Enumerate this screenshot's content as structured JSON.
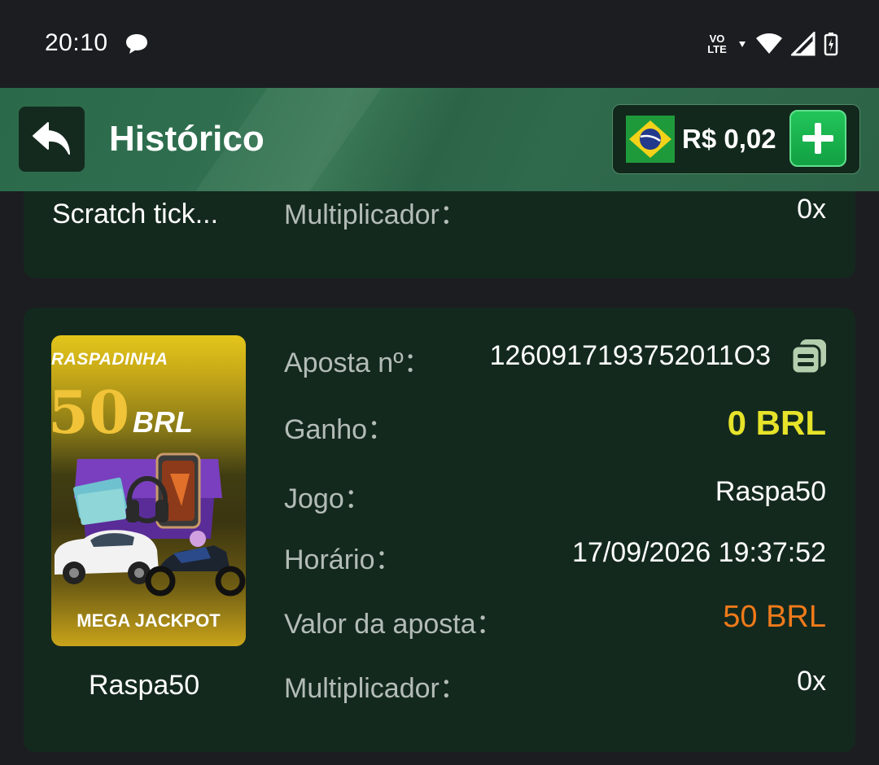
{
  "status_bar": {
    "time": "20:10",
    "network": "VO\nLTE"
  },
  "header": {
    "title": "Histórico",
    "balance": "R$ 0,02"
  },
  "partial_card": {
    "game_name": "Scratch tick...",
    "multiplier_label": "Multiplicador：",
    "multiplier_value": "0x"
  },
  "bet_card": {
    "thumbnail": {
      "title": "RASPADINHA",
      "amount": "50",
      "currency": "BRL",
      "banner": "MEGA JACKPOT"
    },
    "game_name": "Raspa50",
    "rows": [
      {
        "label": "Aposta nº：",
        "value": "1260917193752011O3"
      },
      {
        "label": "Ganho：",
        "value": "0 BRL"
      },
      {
        "label": "Jogo：",
        "value": "Raspa50"
      },
      {
        "label": "Horário：",
        "value": "17/09/2026 19:37:52"
      },
      {
        "label": "Valor da aposta：",
        "value": "50 BRL"
      },
      {
        "label": "Multiplicador：",
        "value": "0x"
      }
    ]
  },
  "colors": {
    "win_value": "#e6e32a",
    "bet_value": "#f07a1a",
    "header_green": "#2f6a4c",
    "card_bg": "#14291e"
  }
}
